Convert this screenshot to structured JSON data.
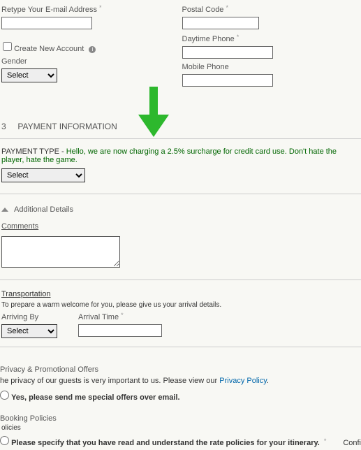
{
  "left": {
    "retype_email_label": "Retype Your E-mail Address",
    "create_account_label": "Create New Account",
    "gender_label": "Gender",
    "gender_select": "Select"
  },
  "right": {
    "postal_label": "Postal Code",
    "daytime_label": "Daytime Phone",
    "mobile_label": "Mobile Phone"
  },
  "section3": {
    "num": "3",
    "title": "PAYMENT INFORMATION"
  },
  "payment": {
    "label": "PAYMENT TYPE - ",
    "msg": "Hello, we are now charging a 2.5% surcharge for credit card use. Don't hate the player, hate the game.",
    "select": "Select"
  },
  "additional": {
    "title": "Additional Details"
  },
  "comments": {
    "label": "Comments"
  },
  "transport": {
    "head": "Transportation",
    "desc": "To prepare a warm welcome for you, please give us your arrival details.",
    "arriving_label": "Arriving By",
    "arriving_select": "Select",
    "arrival_time_label": "Arrival Time"
  },
  "privacy": {
    "head": "Privacy & Promotional Offers",
    "line1a": "he privacy of our guests is very important to us. Please view our ",
    "line1b": "Privacy Policy",
    "line1c": ".",
    "opt": "Yes, please send me special offers over email."
  },
  "booking": {
    "head": "Booking Policies",
    "sub": "olicies",
    "line": "Please specify that you have read and understand the rate policies for your itinerary."
  },
  "footer": {
    "confirm": "Confi"
  },
  "asterisk": "*"
}
